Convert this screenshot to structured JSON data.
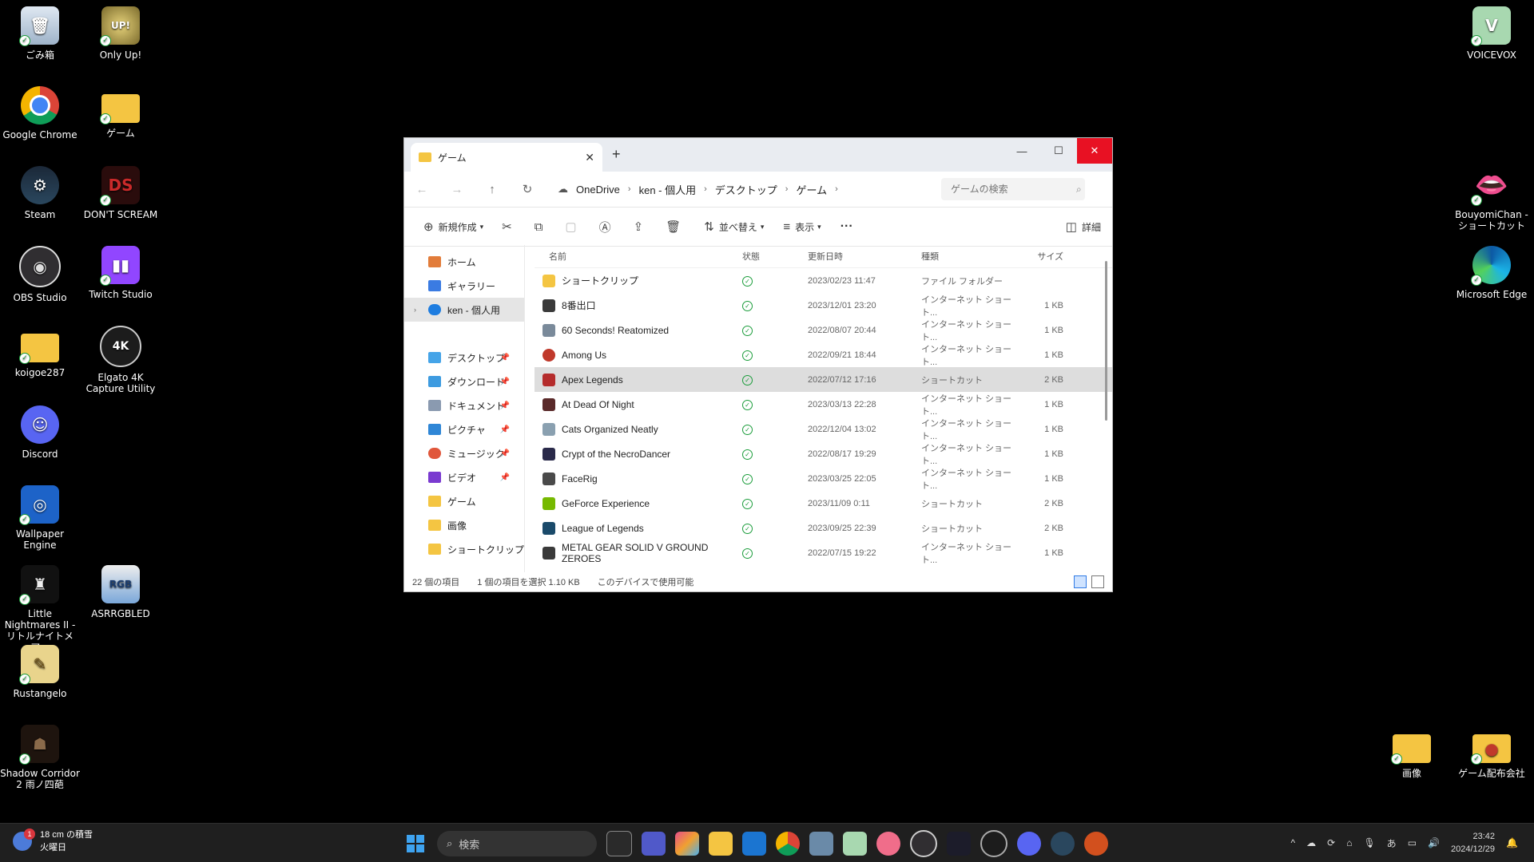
{
  "desktop": {
    "icons": [
      {
        "label": "ごみ箱",
        "icon": "recycle-bin-icon"
      },
      {
        "label": "Only Up!",
        "icon": "only-up-icon"
      },
      {
        "label": "Google Chrome",
        "icon": "chrome-icon"
      },
      {
        "label": "ゲーム",
        "icon": "folder-icon"
      },
      {
        "label": "Steam",
        "icon": "steam-icon"
      },
      {
        "label": "DON'T SCREAM",
        "icon": "dont-scream-icon"
      },
      {
        "label": "OBS Studio",
        "icon": "obs-icon"
      },
      {
        "label": "Twitch Studio",
        "icon": "twitch-icon"
      },
      {
        "label": "koigoe287",
        "icon": "folder-icon"
      },
      {
        "label": "Elgato 4K Capture Utility",
        "icon": "elgato-4k-icon"
      },
      {
        "label": "Discord",
        "icon": "discord-icon"
      },
      {
        "label": "Wallpaper Engine",
        "icon": "wallpaper-engine-icon"
      },
      {
        "label": "Little Nightmares II -リトルナイトメア...",
        "icon": "little-nightmares-icon"
      },
      {
        "label": "ASRRGBLED",
        "icon": "asrrgbled-icon"
      },
      {
        "label": "Rustangelo",
        "icon": "rustangelo-icon"
      },
      {
        "label": "Shadow Corridor 2 雨ノ四葩",
        "icon": "shadow-corridor-icon"
      },
      {
        "label": "VOICEVOX",
        "icon": "voicevox-icon"
      },
      {
        "label": "BouyomiChan - ショートカット",
        "icon": "bouyomichan-icon"
      },
      {
        "label": "Microsoft Edge",
        "icon": "edge-icon"
      },
      {
        "label": "画像",
        "icon": "folder-icon"
      },
      {
        "label": "ゲーム配布会社",
        "icon": "folder-icon"
      }
    ]
  },
  "window": {
    "tab_title": "ゲーム",
    "new_tab": "+",
    "breadcrumb": [
      "OneDrive",
      "ken - 個人用",
      "デスクトップ",
      "ゲーム"
    ],
    "search_placeholder": "ゲームの検索",
    "toolbar": {
      "new": "新規作成",
      "sort": "並べ替え",
      "view": "表示",
      "more": "···",
      "details": "詳細"
    },
    "sidebar": [
      {
        "label": "ホーム"
      },
      {
        "label": "ギャラリー"
      },
      {
        "label": "ken - 個人用"
      },
      {
        "label": "デスクトップ"
      },
      {
        "label": "ダウンロード"
      },
      {
        "label": "ドキュメント"
      },
      {
        "label": "ピクチャ"
      },
      {
        "label": "ミュージック"
      },
      {
        "label": "ビデオ"
      },
      {
        "label": "ゲーム"
      },
      {
        "label": "画像"
      },
      {
        "label": "ショートクリップ"
      }
    ],
    "columns": {
      "name": "名前",
      "status": "状態",
      "date": "更新日時",
      "type": "種類",
      "size": "サイズ"
    },
    "files": [
      {
        "name": "ショートクリップ",
        "date": "2023/02/23 11:47",
        "type": "ファイル フォルダー",
        "size": ""
      },
      {
        "name": "8番出口",
        "date": "2023/12/01 23:20",
        "type": "インターネット ショート...",
        "size": "1 KB"
      },
      {
        "name": "60 Seconds! Reatomized",
        "date": "2022/08/07 20:44",
        "type": "インターネット ショート...",
        "size": "1 KB"
      },
      {
        "name": "Among Us",
        "date": "2022/09/21 18:44",
        "type": "インターネット ショート...",
        "size": "1 KB"
      },
      {
        "name": "Apex Legends",
        "date": "2022/07/12 17:16",
        "type": "ショートカット",
        "size": "2 KB"
      },
      {
        "name": "At Dead Of Night",
        "date": "2023/03/13 22:28",
        "type": "インターネット ショート...",
        "size": "1 KB"
      },
      {
        "name": "Cats Organized Neatly",
        "date": "2022/12/04 13:02",
        "type": "インターネット ショート...",
        "size": "1 KB"
      },
      {
        "name": "Crypt of the NecroDancer",
        "date": "2022/08/17 19:29",
        "type": "インターネット ショート...",
        "size": "1 KB"
      },
      {
        "name": "FaceRig",
        "date": "2023/03/25 22:05",
        "type": "インターネット ショート...",
        "size": "1 KB"
      },
      {
        "name": "GeForce Experience",
        "date": "2023/11/09 0:11",
        "type": "ショートカット",
        "size": "2 KB"
      },
      {
        "name": "League of Legends",
        "date": "2023/09/25 22:39",
        "type": "ショートカット",
        "size": "2 KB"
      },
      {
        "name": "METAL GEAR SOLID V GROUND ZEROES",
        "date": "2022/07/15 19:22",
        "type": "インターネット ショート...",
        "size": "1 KB"
      }
    ],
    "status": {
      "count": "22 個の項目",
      "selected": "1 個の項目を選択 1.10 KB",
      "availability": "このデバイスで使用可能"
    }
  },
  "taskbar": {
    "weather_temp": "18 cm の積雪",
    "weather_day": "火曜日",
    "weather_badge": "1",
    "search_label": "検索",
    "clock_time": "23:42",
    "clock_date": "2024/12/29",
    "ime": "あ"
  },
  "colors": {
    "close_red": "#e81123",
    "sync_green": "#1a9c3a",
    "taskbar_bg": "#1f1f1f",
    "folder_yellow": "#f4c542"
  }
}
